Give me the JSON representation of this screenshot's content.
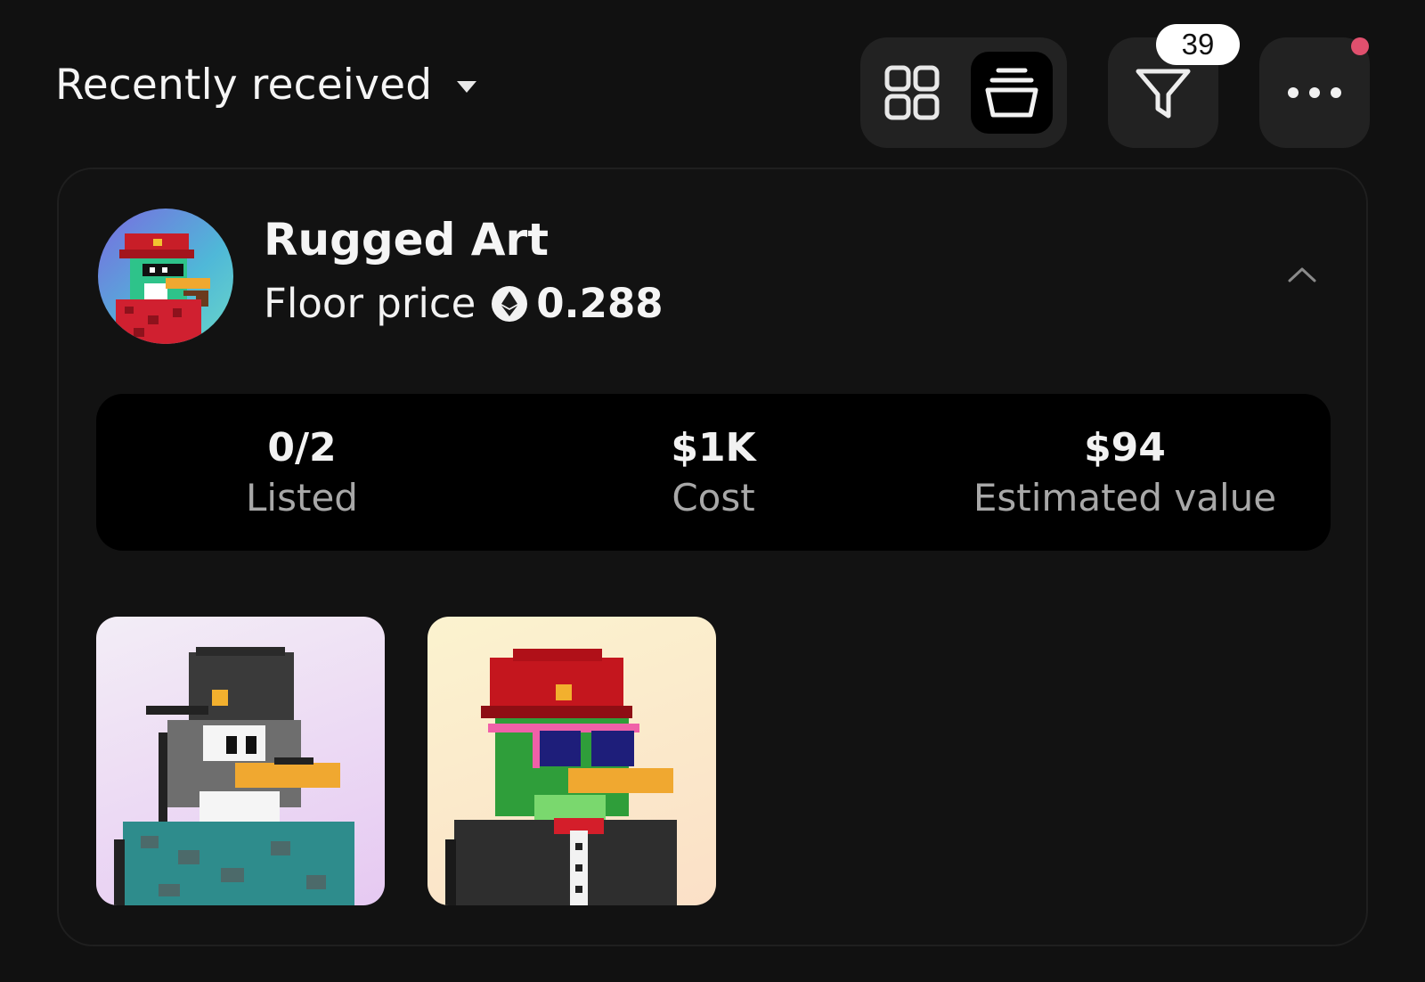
{
  "header": {
    "sort_label": "Recently received",
    "filter_badge_count": "39",
    "view_mode_selected": "list",
    "icons": [
      "chevron-down-icon",
      "grid-view-icon",
      "list-view-icon",
      "filter-icon",
      "more-icon"
    ],
    "notification_dot_color": "#e0506e"
  },
  "collection": {
    "name": "Rugged Art",
    "floor_label": "Floor price",
    "floor_value": "0.288",
    "currency_icon": "ethereum-icon",
    "expanded": true,
    "stats": [
      {
        "value": "0/2",
        "label": "Listed"
      },
      {
        "value": "$1K",
        "label": "Cost"
      },
      {
        "value": "$94",
        "label": "Estimated value"
      }
    ],
    "nfts": [
      {
        "art": "pixel-penguin-cap"
      },
      {
        "art": "pixel-duck-officer"
      }
    ]
  }
}
